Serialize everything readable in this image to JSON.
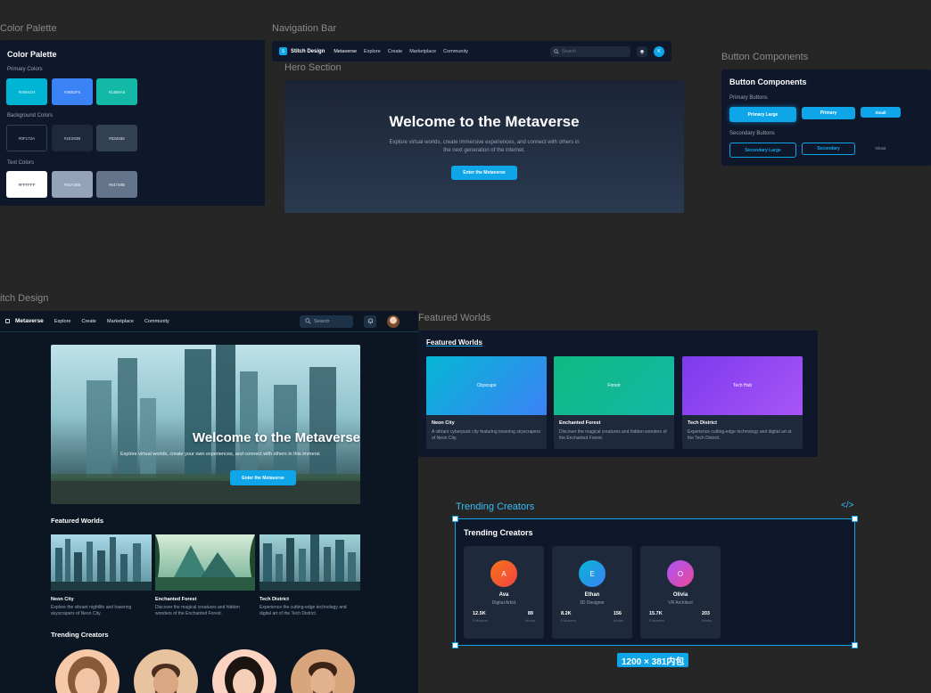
{
  "labels": {
    "color_palette": "Color Palette",
    "navigation_bar": "Navigation Bar",
    "hero_section": "Hero Section",
    "button_components": "Button Components",
    "stitch_design": "itch Design",
    "featured_worlds": "Featured Worlds",
    "trending_creators": "Trending Creators"
  },
  "palette": {
    "title": "Color Palette",
    "primary_title": "Primary Colors",
    "background_title": "Background Colors",
    "text_title": "Text Colors",
    "primary": [
      "#00B4D4",
      "#3B82F6",
      "#14B8A6"
    ],
    "background": [
      "#0F172A",
      "#1E293B",
      "#334155"
    ],
    "text": [
      "#FFFFFF",
      "#94A3B8",
      "#64748B"
    ]
  },
  "navbar": {
    "brand": "Stitch Design",
    "links": [
      "Metaverse",
      "Explore",
      "Create",
      "Marketplace",
      "Community"
    ],
    "search_placeholder": "Search",
    "avatar_initial": "K"
  },
  "hero": {
    "title": "Welcome to the Metaverse",
    "text": "Explore virtual worlds, create immersive experiences, and connect with others in the next generation of the internet.",
    "cta": "Enter the Metaverse"
  },
  "buttons": {
    "title": "Button Components",
    "primary_title": "Primary Buttons",
    "secondary_title": "Secondary Buttons",
    "primary_large": "Primary Large",
    "primary": "Primary",
    "small": "Small",
    "secondary_large": "Secondary Large",
    "secondary": "Secondary",
    "ghost": "Ghost"
  },
  "stitch": {
    "brand": "Metaverse",
    "links": [
      "Explore",
      "Create",
      "Marketplace",
      "Community"
    ],
    "search_placeholder": "Search",
    "hero_title": "Welcome to the Metaverse",
    "hero_text": "Explore virtual worlds, create your own experiences, and connect with others in this immersi",
    "hero_cta": "Enter the Metaverse",
    "featured_title": "Featured Worlds",
    "worlds": [
      {
        "title": "Neon City",
        "desc": "Explore the vibrant nightlife and towering skyscrapers of Neon City."
      },
      {
        "title": "Enchanted Forest",
        "desc": "Discover the magical creatures and hidden wonders of the Enchanted Forest."
      },
      {
        "title": "Tech District",
        "desc": "Experience the cutting-edge technology and digital art of the Tech District."
      }
    ],
    "trending_title": "Trending Creators"
  },
  "featured": {
    "title": "Featured Worlds",
    "cards": [
      {
        "thumb": "Cityscape",
        "title": "Neon City",
        "desc": "A vibrant cyberpunk city featuring towering skyscrapers of Neon City."
      },
      {
        "thumb": "Forest",
        "title": "Enchanted Forest",
        "desc": "Discover the magical creatures and hidden wonders of the Enchanted Forest."
      },
      {
        "thumb": "Tech Hub",
        "title": "Tech District",
        "desc": "Experience cutting-edge technology and digital art at the Tech District."
      }
    ]
  },
  "creators": {
    "title": "Trending Creators",
    "followers_label": "Followers",
    "works_label": "Works",
    "items": [
      {
        "initial": "A",
        "name": "Ava",
        "role": "Digital Artist",
        "followers": "12.5K",
        "works": "89"
      },
      {
        "initial": "E",
        "name": "Ethan",
        "role": "3D Designer",
        "followers": "8.2K",
        "works": "156"
      },
      {
        "initial": "O",
        "name": "Olivia",
        "role": "VR Architect",
        "followers": "15.7K",
        "works": "203"
      }
    ]
  },
  "selection": {
    "size_label": "1200 × 381内包",
    "code_icon": "code-icon"
  },
  "colors": {
    "accent": "#0EA5E9",
    "canvas": "#262626",
    "panel": "#0F172A"
  }
}
